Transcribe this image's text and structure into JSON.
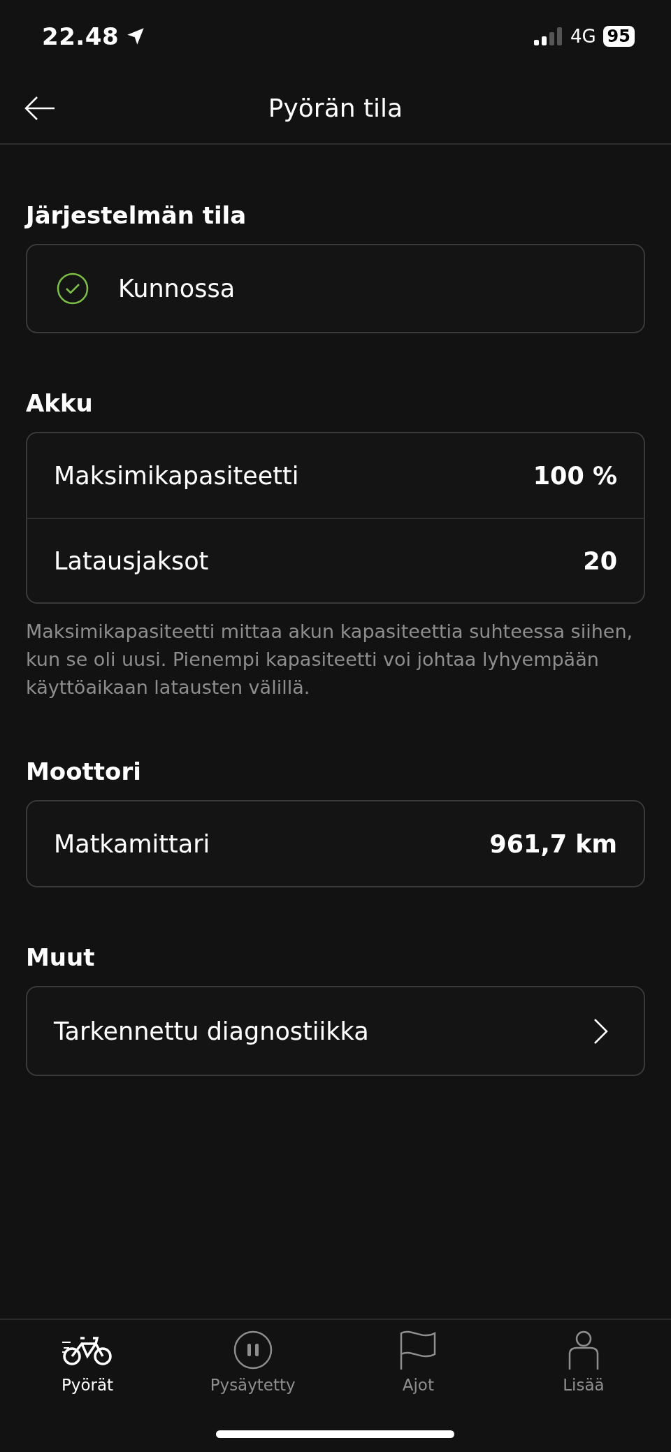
{
  "status_bar": {
    "time": "22.48",
    "network": "4G",
    "battery": "95"
  },
  "header": {
    "title": "Pyörän tila"
  },
  "sections": [
    {
      "title": "Järjestelmän tila",
      "rows": [
        {
          "kind": "status",
          "label": "Kunnossa"
        }
      ]
    },
    {
      "title": "Akku",
      "rows": [
        {
          "kind": "value",
          "label": "Maksimikapasiteetti",
          "value": "100 %"
        },
        {
          "kind": "value",
          "label": "Latausjaksot",
          "value": "20"
        }
      ],
      "note": "Maksimikapasiteetti mittaa akun kapasiteettia suhteessa siihen, kun se oli uusi. Pienempi kapasiteetti voi johtaa lyhyempään käyttöaikaan latausten välillä."
    },
    {
      "title": "Moottori",
      "rows": [
        {
          "kind": "value",
          "label": "Matkamittari",
          "value": "961,7 km"
        }
      ]
    },
    {
      "title": "Muut",
      "rows": [
        {
          "kind": "link",
          "label": "Tarkennettu diagnostiikka"
        }
      ]
    }
  ],
  "tab_bar": [
    {
      "label": "Pyörät",
      "selected": true
    },
    {
      "label": "Pysäytetty",
      "selected": false
    },
    {
      "label": "Ajot",
      "selected": false
    },
    {
      "label": "Lisää",
      "selected": false
    }
  ]
}
